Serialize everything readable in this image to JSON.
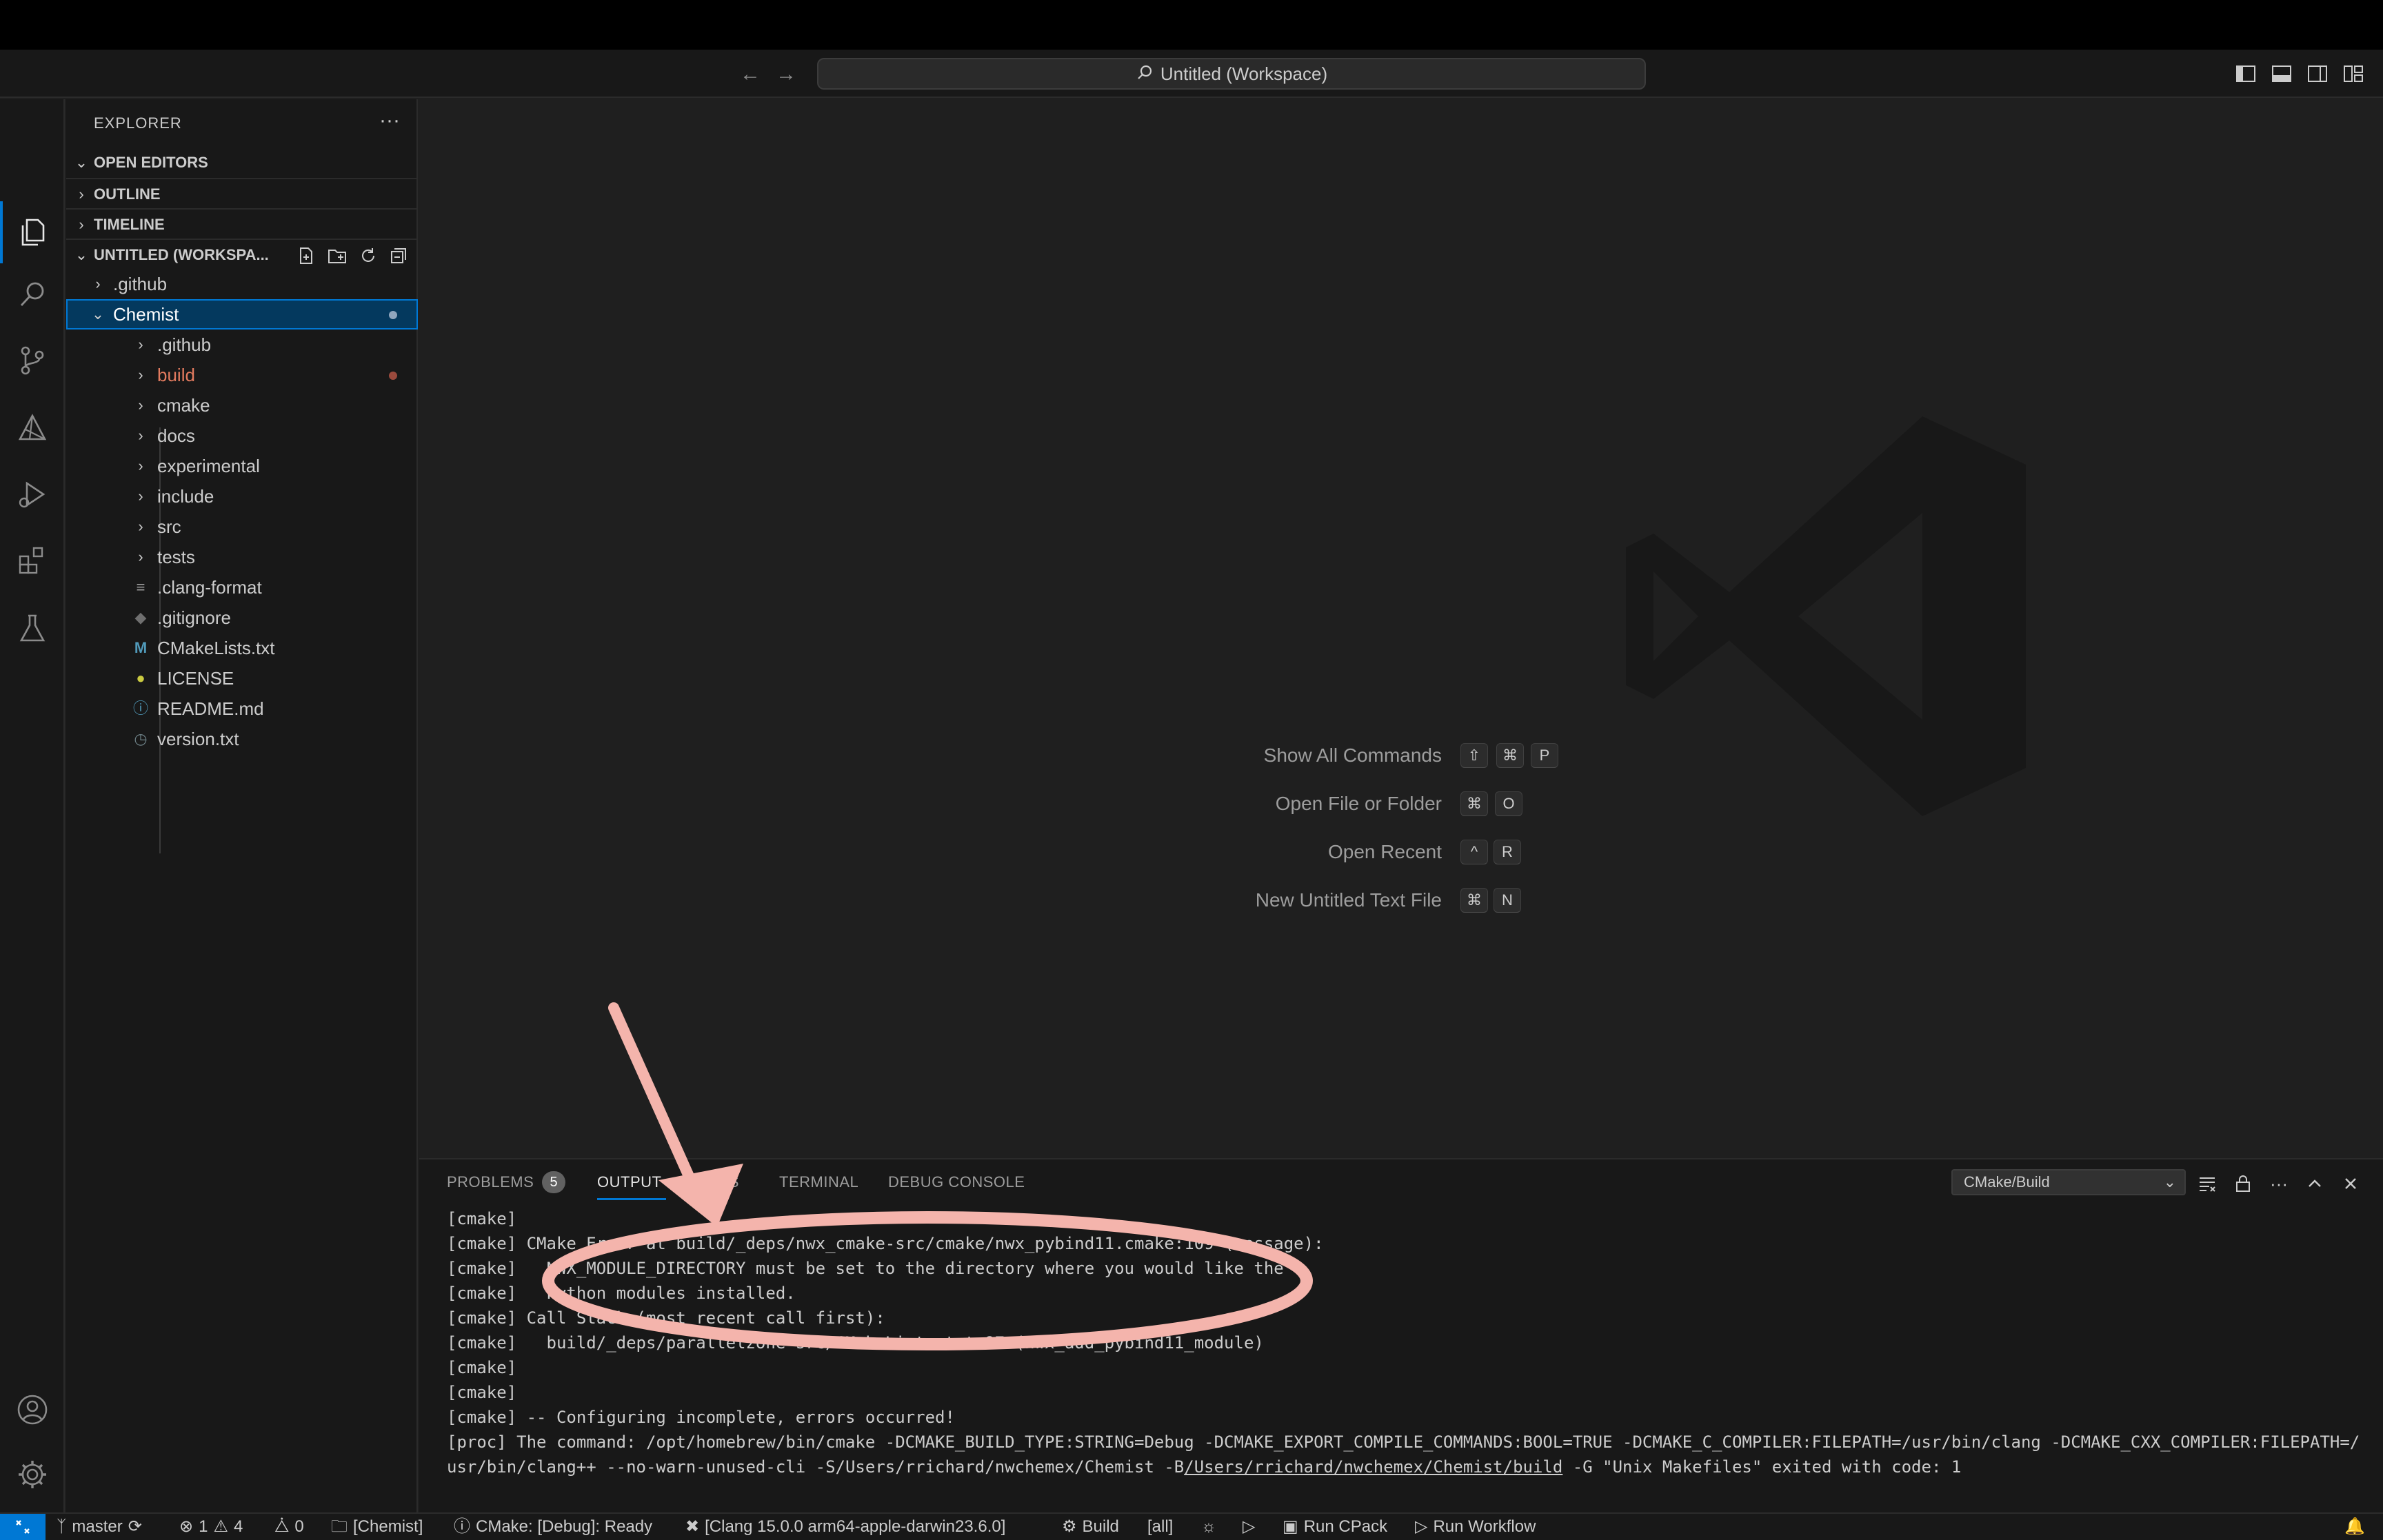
{
  "window": {
    "title": "Untitled (Workspace)"
  },
  "sidebar": {
    "title": "EXPLORER",
    "sections": {
      "open_editors": "OPEN EDITORS",
      "outline": "OUTLINE",
      "timeline": "TIMELINE",
      "workspace": "UNTITLED (WORKSPA..."
    },
    "tree": [
      {
        "label": ".github",
        "type": "folder",
        "level": 1,
        "expanded": false
      },
      {
        "label": "Chemist",
        "type": "folder",
        "level": 1,
        "expanded": true,
        "selected": true
      },
      {
        "label": ".github",
        "type": "folder",
        "level": 2,
        "expanded": false
      },
      {
        "label": "build",
        "type": "folder",
        "level": 2,
        "expanded": false,
        "status": "modified"
      },
      {
        "label": "cmake",
        "type": "folder",
        "level": 2,
        "expanded": false
      },
      {
        "label": "docs",
        "type": "folder",
        "level": 2,
        "expanded": false
      },
      {
        "label": "experimental",
        "type": "folder",
        "level": 2,
        "expanded": false
      },
      {
        "label": "include",
        "type": "folder",
        "level": 2,
        "expanded": false
      },
      {
        "label": "src",
        "type": "folder",
        "level": 2,
        "expanded": false
      },
      {
        "label": "tests",
        "type": "folder",
        "level": 2,
        "expanded": false
      },
      {
        "label": ".clang-format",
        "type": "file",
        "level": 2,
        "icon": "lines-icon"
      },
      {
        "label": ".gitignore",
        "type": "file",
        "level": 2,
        "icon": "git-diamond-icon"
      },
      {
        "label": "CMakeLists.txt",
        "type": "file",
        "level": 2,
        "icon": "m-icon"
      },
      {
        "label": "LICENSE",
        "type": "file",
        "level": 2,
        "icon": "license-icon"
      },
      {
        "label": "README.md",
        "type": "file",
        "level": 2,
        "icon": "info-icon"
      },
      {
        "label": "version.txt",
        "type": "file",
        "level": 2,
        "icon": "clock-icon"
      }
    ]
  },
  "editor": {
    "hints": [
      {
        "label": "Show All Commands",
        "keys": [
          "⇧",
          "⌘",
          "P"
        ]
      },
      {
        "label": "Open File or Folder",
        "keys": [
          "⌘",
          "O"
        ]
      },
      {
        "label": "Open Recent",
        "keys": [
          "^",
          "R"
        ]
      },
      {
        "label": "New Untitled Text File",
        "keys": [
          "⌘",
          "N"
        ]
      }
    ]
  },
  "panel": {
    "tabs": {
      "problems": "PROBLEMS",
      "problems_count": "5",
      "output": "OUTPUT",
      "ports": "PORTS",
      "terminal": "TERMINAL",
      "debug_console": "DEBUG CONSOLE"
    },
    "output_channel": "CMake/Build",
    "lines": [
      "[cmake]",
      "[cmake] CMake Error at build/_deps/nwx_cmake-src/cmake/nwx_pybind11.cmake:109 (message):",
      "[cmake]   NWX_MODULE_DIRECTORY must be set to the directory where you would like the",
      "[cmake]   Python modules installed.",
      "[cmake] Call Stack (most recent call first):",
      "[cmake]   build/_deps/parallelzone-src/CMakeLists.txt:97 (nwx_add_pybind11_module)",
      "[cmake]",
      "[cmake]",
      "[cmake] -- Configuring incomplete, errors occurred!",
      "[proc] The command: /opt/homebrew/bin/cmake -DCMAKE_BUILD_TYPE:STRING=Debug -DCMAKE_EXPORT_COMPILE_COMMANDS:BOOL=TRUE -DCMAKE_C_COMPILER:FILEPATH=/usr/bin/clang -DCMAKE_CXX_COMPILER:FILEPATH=/"
    ],
    "last_line": {
      "before": "usr/bin/clang++ --no-warn-unused-cli -S/Users/rrichard/nwchemex/Chemist -B",
      "link": "/Users/rrichard/nwchemex/Chemist/build",
      "after": " -G \"Unix Makefiles\" exited with code: 1"
    }
  },
  "statusbar": {
    "branch": "master",
    "errors": "1",
    "warnings": "4",
    "ports": "0",
    "folder": "[Chemist]",
    "cmake_status": "CMake: [Debug]: Ready",
    "kit": "[Clang 15.0.0 arm64-apple-darwin23.6.0]",
    "build": "Build",
    "target": "[all]",
    "run_cpack": "Run CPack",
    "run_workflow": "Run Workflow"
  },
  "colors": {
    "accent": "#0078d4",
    "modified": "#e37b5f",
    "annotation": "#f4b4ac"
  }
}
